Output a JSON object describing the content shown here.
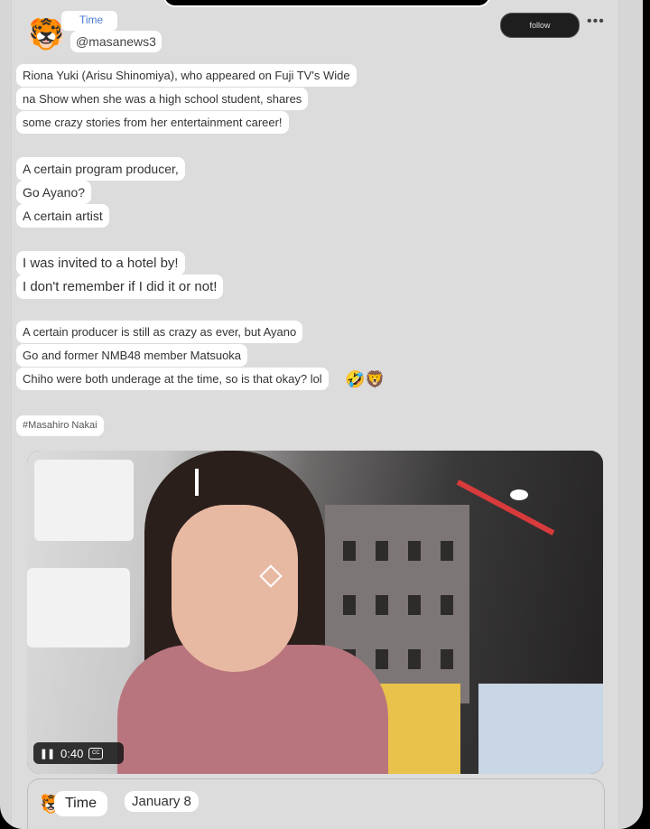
{
  "post": {
    "time_label": "Time",
    "handle": "@masanews3",
    "follow_label": "follow",
    "more_label": "•••",
    "avatar_emoji": "🐯",
    "lines": [
      "Riona Yuki (Arisu Shinomiya), who appeared on Fuji TV's Wide",
      "na Show when she was a high school student, shares",
      "some crazy stories from her entertainment career!",
      "A certain program producer,",
      "Go Ayano?",
      "A certain artist",
      "I was invited to a hotel by!",
      "I don't remember if I did it or not!",
      "A certain producer is still as crazy as ever, but Ayano",
      "Go and former NMB48 member Matsuoka",
      "Chiho were both underage at the time, so is that okay? lol"
    ],
    "trailing_emojis": "🤣🦁",
    "hashtag": "#Masahiro Nakai",
    "video": {
      "pause_icon": "❚❚",
      "current_time": "0:40",
      "cc_label": "CC"
    }
  },
  "next_post": {
    "avatar_emoji": "🐯",
    "time_label": "Time",
    "date": "January 8"
  }
}
